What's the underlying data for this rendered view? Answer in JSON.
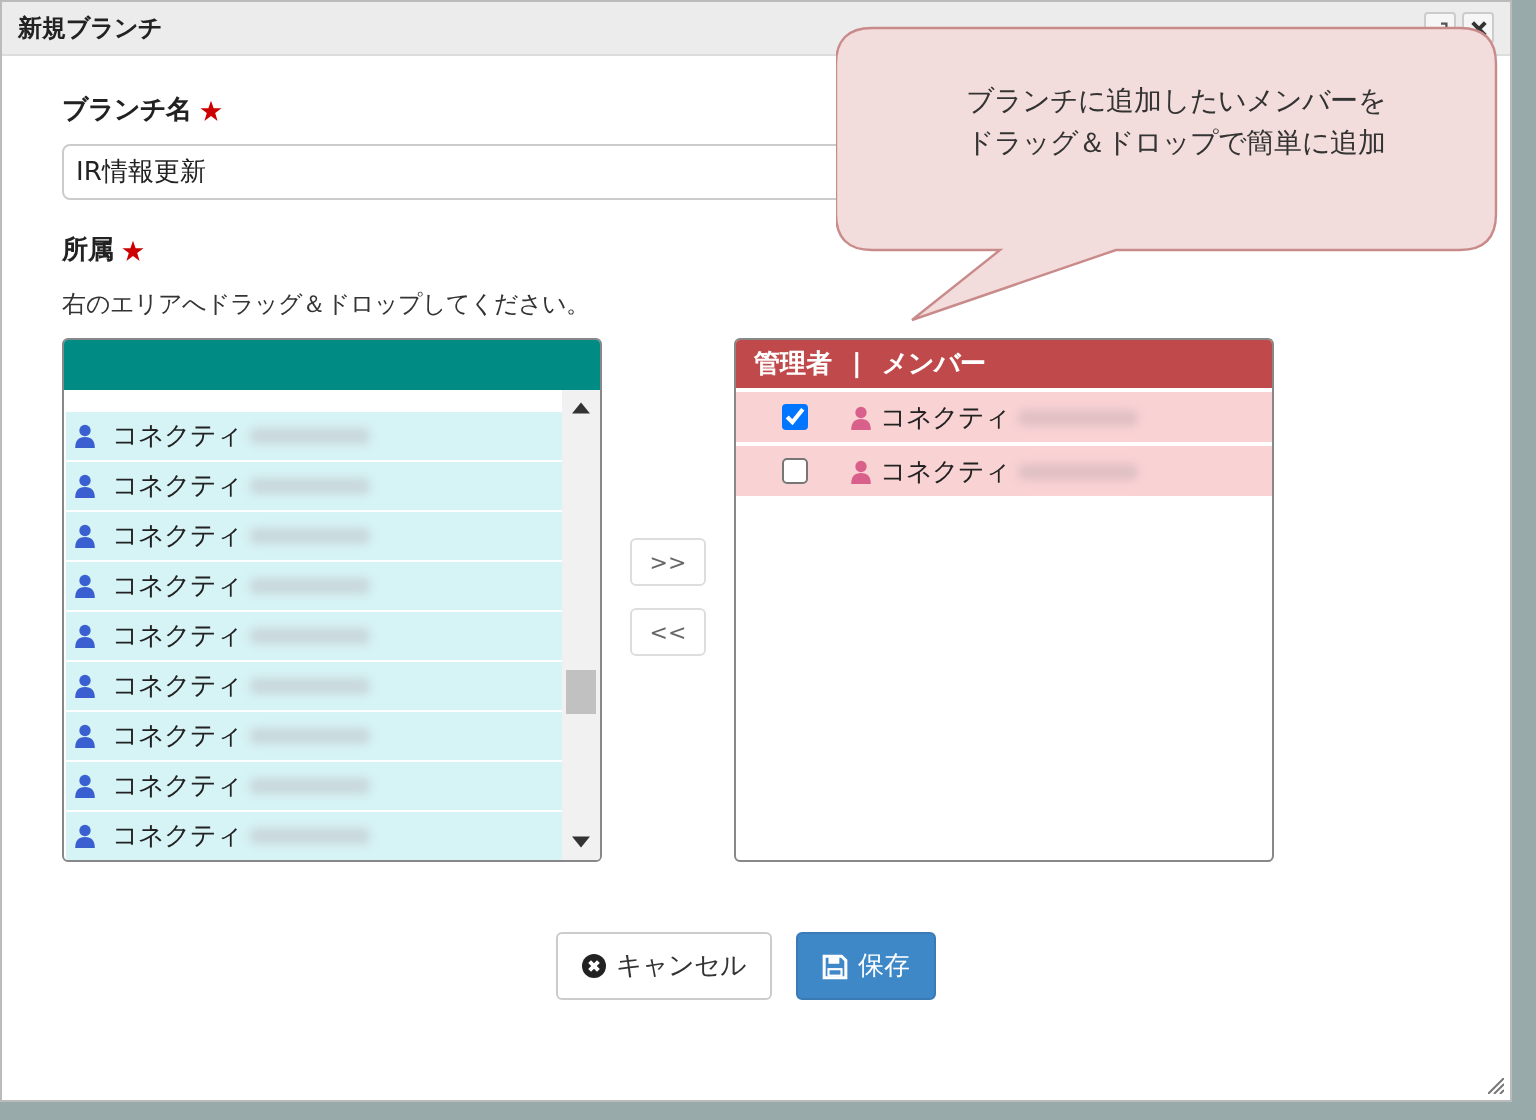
{
  "dialog": {
    "title": "新規ブランチ"
  },
  "branch_name": {
    "label": "ブランチ名",
    "required": true,
    "value": "IR情報更新"
  },
  "affiliation": {
    "label": "所属",
    "required": true,
    "hint": "右のエリアへドラッグ＆ドロップしてください。"
  },
  "available_members": [
    {
      "name": "コネクティ"
    },
    {
      "name": "コネクティ"
    },
    {
      "name": "コネクティ"
    },
    {
      "name": "コネクティ"
    },
    {
      "name": "コネクティ"
    },
    {
      "name": "コネクティ"
    },
    {
      "name": "コネクティ"
    },
    {
      "name": "コネクティ"
    },
    {
      "name": "コネクティ"
    }
  ],
  "transfer_buttons": [
    ">>",
    "<<"
  ],
  "selected_members": {
    "columns": [
      "管理者",
      "|",
      "メンバー"
    ],
    "rows": [
      {
        "admin": true,
        "name": "コネクティ"
      },
      {
        "admin": false,
        "name": "コネクティ"
      }
    ]
  },
  "buttons": [
    {
      "kind": "cancel",
      "label": "キャンセル"
    },
    {
      "kind": "save",
      "label": "保存"
    }
  ],
  "callout": {
    "lines": [
      "ブランチに追加したいメンバーを",
      "ドラッグ＆ドロップで簡単に追加"
    ]
  }
}
